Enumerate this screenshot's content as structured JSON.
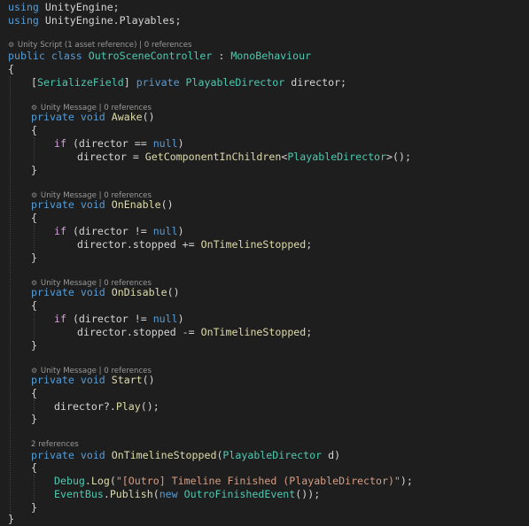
{
  "editor": {
    "colors": {
      "background": "#1e1e1e",
      "text": "#d4d4d4",
      "keyword": "#569cd6",
      "control_keyword": "#d8a0df",
      "type": "#4ec9b0",
      "method": "#dcdcaa",
      "string": "#d69d85",
      "codelens": "#999999"
    },
    "using_keyword": "using",
    "using_lines": [
      "UnityEngine;",
      "UnityEngine.Playables;"
    ],
    "class_lens": "Unity Script (1 asset reference) | 0 references",
    "class_decl": {
      "public_kw": "public",
      "class_kw": "class",
      "name": "OutroSceneController",
      "colon": " : ",
      "base": "MonoBehaviour"
    },
    "field_line": {
      "attr_open": "[",
      "attr": "SerializeField",
      "attr_close": "]",
      "access": "private",
      "type": "PlayableDirector",
      "rest": " director;"
    },
    "methods": [
      {
        "lens": "Unity Message | 0 references",
        "access": "private",
        "ret": "void",
        "name": "Awake",
        "params": "()",
        "cond_kw": "if",
        "cond_a": " (director == ",
        "cond_null": "null",
        "cond_b": ")",
        "stmt_a": "director = ",
        "stmt_fn": "GetComponentInChildren",
        "stmt_lt": "<",
        "stmt_type": "PlayableDirector",
        "stmt_end": ">();"
      },
      {
        "lens": "Unity Message | 0 references",
        "access": "private",
        "ret": "void",
        "name": "OnEnable",
        "params": "()",
        "cond_kw": "if",
        "cond_a": " (director != ",
        "cond_null": "null",
        "cond_b": ")",
        "stmt_a": "director.stopped += ",
        "stmt_fn": "OnTimelineStopped",
        "stmt_end": ";"
      },
      {
        "lens": "Unity Message | 0 references",
        "access": "private",
        "ret": "void",
        "name": "OnDisable",
        "params": "()",
        "cond_kw": "if",
        "cond_a": " (director != ",
        "cond_null": "null",
        "cond_b": ")",
        "stmt_a": "director.stopped -= ",
        "stmt_fn": "OnTimelineStopped",
        "stmt_end": ";"
      },
      {
        "lens": "Unity Message | 0 references",
        "access": "private",
        "ret": "void",
        "name": "Start",
        "params": "()",
        "stmt_a": "director?.",
        "stmt_fn": "Play",
        "stmt_end": "();"
      },
      {
        "lens": "2 references",
        "access": "private",
        "ret": "void",
        "name": "OnTimelineStopped",
        "params_open": "(",
        "param_type": "PlayableDirector",
        "params_rest": " d)",
        "line1_type": "Debug",
        "line1_dot": ".",
        "line1_fn": "Log",
        "line1_open": "(",
        "line1_str": "\"[Outro] Timeline Finished (PlayableDirector)\"",
        "line1_end": ");",
        "line2_type": "EventBus",
        "line2_dot": ".",
        "line2_fn": "Publish",
        "line2_open": "(",
        "line2_new": "new",
        "line2_space": " ",
        "line2_ntype": "OutroFinishedEvent",
        "line2_end": "());"
      }
    ],
    "open_brace": "{",
    "close_brace": "}"
  }
}
